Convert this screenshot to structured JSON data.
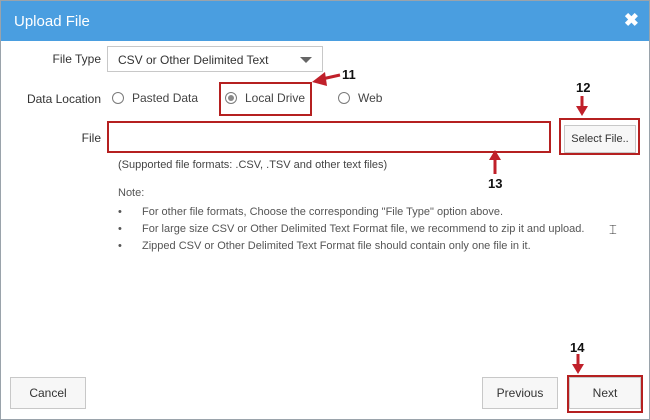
{
  "dialog": {
    "title": "Upload File"
  },
  "file_type": {
    "label": "File Type",
    "value": "CSV or Other Delimited Text"
  },
  "data_location": {
    "label": "Data Location",
    "options": [
      {
        "label": "Pasted Data",
        "checked": false
      },
      {
        "label": "Local Drive",
        "checked": true
      },
      {
        "label": "Web",
        "checked": false
      }
    ]
  },
  "file": {
    "label": "File",
    "value": "",
    "select_button": "Select File..",
    "supported": "(Supported file formats: .CSV, .TSV and other text files)"
  },
  "note": {
    "title": "Note:",
    "items": [
      "For other file formats, Choose the corresponding \"File Type\" option above.",
      "For large size CSV or Other Delimited Text Format file, we recommend to zip it and upload.",
      "Zipped CSV or Other Delimited Text Format file should contain only one file in it."
    ]
  },
  "footer": {
    "cancel": "Cancel",
    "previous": "Previous",
    "next": "Next"
  },
  "annotations": {
    "n11": "11",
    "n12": "12",
    "n13": "13",
    "n14": "14"
  },
  "colors": {
    "titlebar": "#4a9ee0",
    "highlight": "#b52020"
  }
}
